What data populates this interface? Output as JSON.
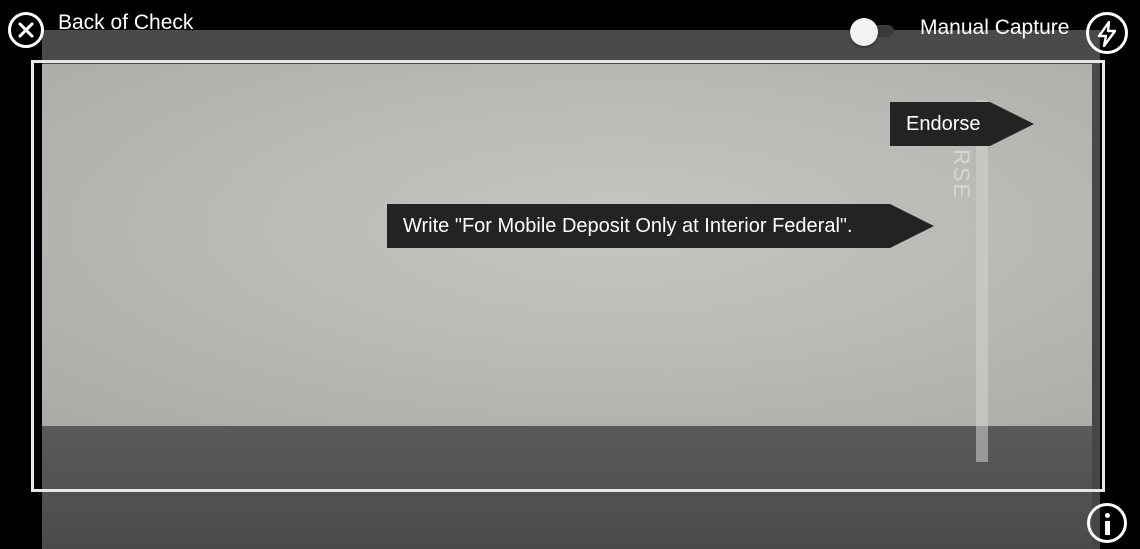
{
  "header": {
    "title": "Back of Check",
    "toggle_label": "Manual Capture",
    "toggle_on": false
  },
  "preview": {
    "check_print": "ORSE"
  },
  "callouts": {
    "endorse": "Endorse",
    "instruction": "Write \"For Mobile Deposit Only at Interior Federal\"."
  },
  "icons": {
    "close": "close-circle-icon",
    "flash": "flash-icon",
    "info": "info-icon"
  },
  "colors": {
    "background": "#000000",
    "frame": "#e6e6e6",
    "callout": "#232323",
    "text": "#ffffff"
  }
}
